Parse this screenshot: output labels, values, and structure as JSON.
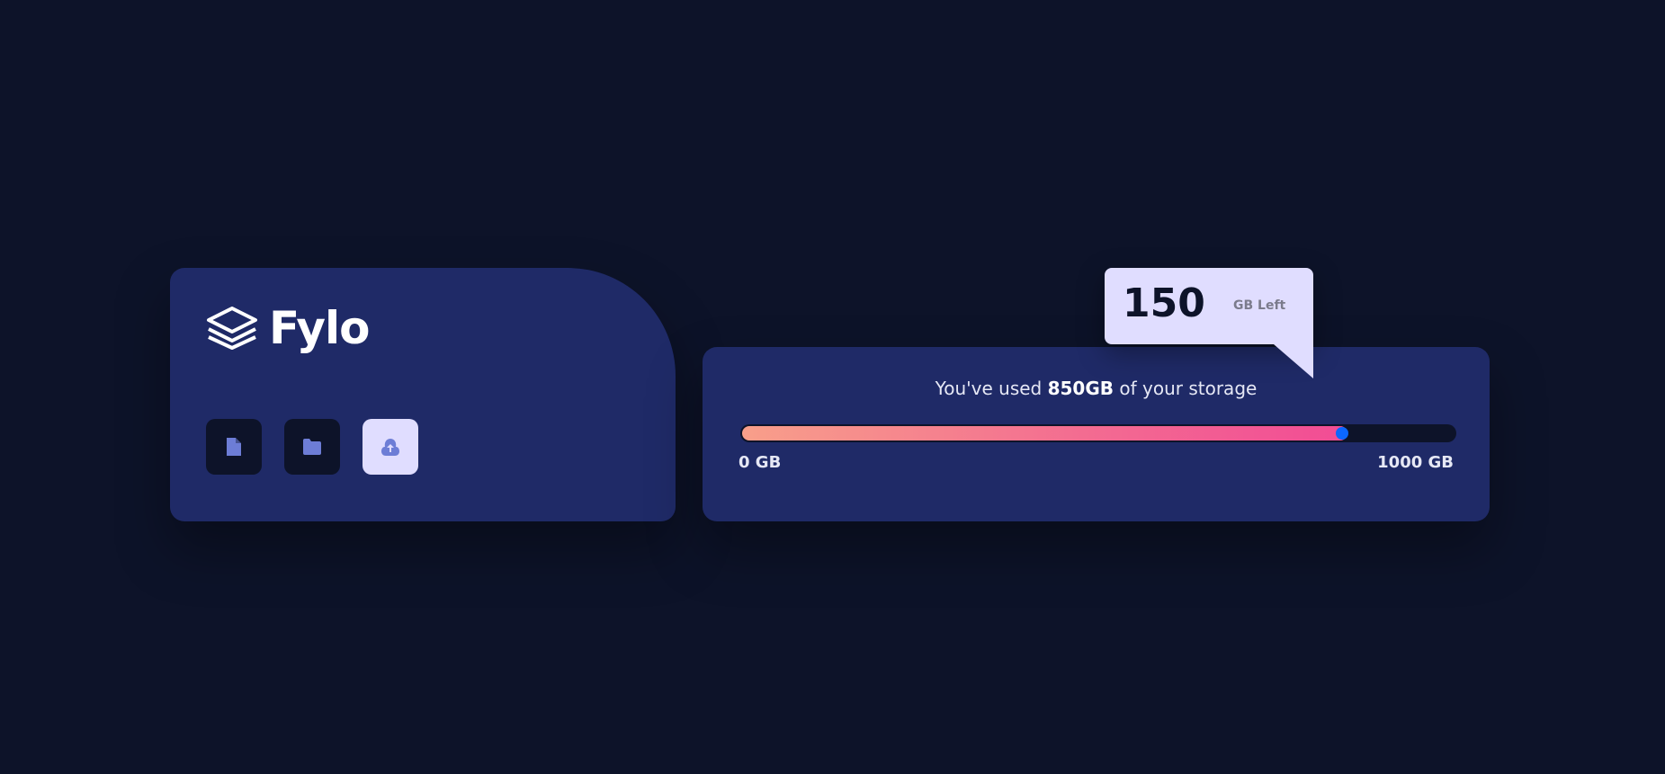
{
  "brand": {
    "name": "Fylo",
    "logo_icon": "layers-icon"
  },
  "actions": [
    {
      "name": "upload-document",
      "icon": "document-icon",
      "active": false
    },
    {
      "name": "upload-folder",
      "icon": "folder-icon",
      "active": false
    },
    {
      "name": "upload-cloud",
      "icon": "cloud-upload-icon",
      "active": true
    }
  ],
  "storage": {
    "usage_prefix": "You've used ",
    "usage_amount": "850GB",
    "usage_suffix": " of your storage",
    "used_fraction": 0.85,
    "min_label": "0 GB",
    "max_label": "1000 GB"
  },
  "remaining": {
    "value": "150",
    "unit": "GB Left"
  },
  "colors": {
    "background": "#0d1329",
    "card": "#1f2a67",
    "tooltip": "#e0ddff",
    "icon": "#6d7dd6",
    "gradient_start": "#f89f8a",
    "gradient_end": "#f24c95",
    "knob": "#0b67ff"
  }
}
